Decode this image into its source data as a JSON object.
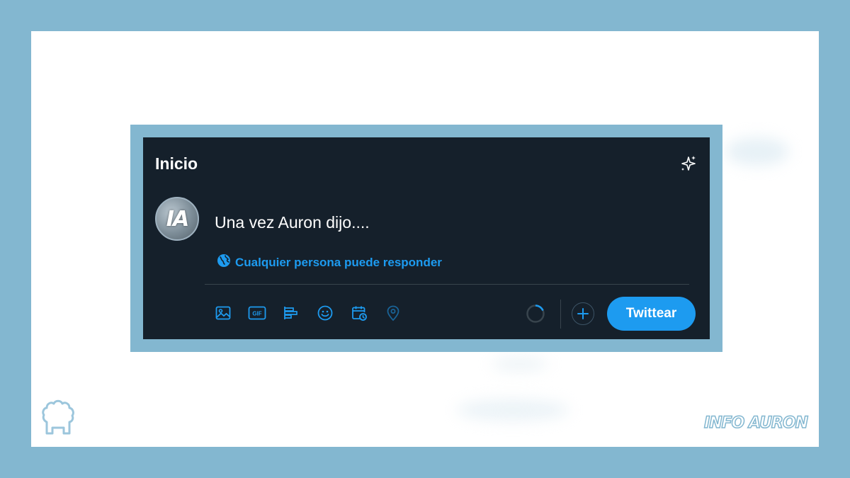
{
  "header": {
    "title": "Inicio"
  },
  "avatar": {
    "initials": "IA"
  },
  "composer": {
    "text": "Una vez Auron dijo...."
  },
  "reply_setting": {
    "label": "Cualquier persona puede responder"
  },
  "toolbar": {
    "icons": [
      "image-icon",
      "gif-icon",
      "poll-icon",
      "emoji-icon",
      "schedule-icon",
      "location-icon"
    ],
    "gif_label": "GIF",
    "tweet_label": "Twittear"
  },
  "footer": {
    "brand": "INFO AURON"
  },
  "colors": {
    "frame": "#83b7d0",
    "panel": "#15202b",
    "accent": "#1d9bf0",
    "divider": "#38444d"
  }
}
